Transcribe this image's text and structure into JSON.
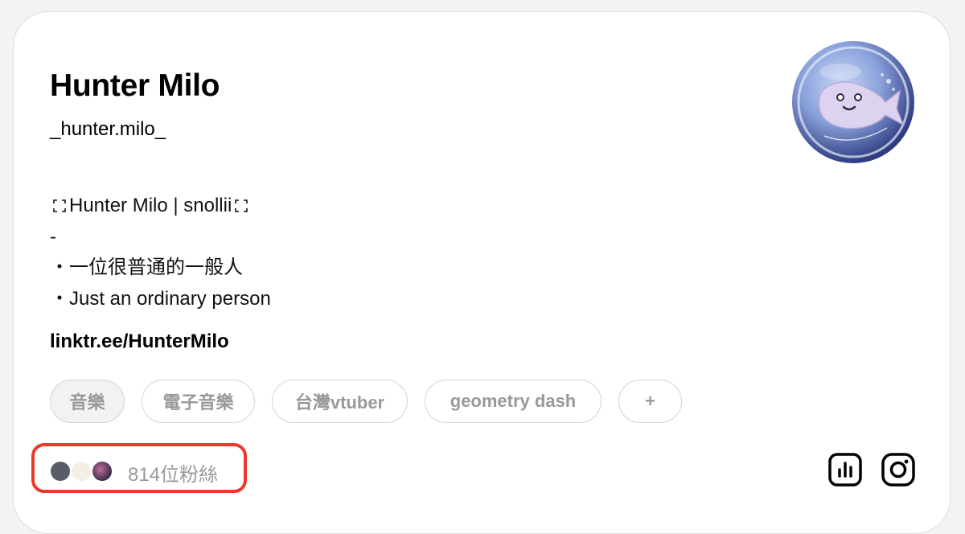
{
  "profile": {
    "name": "Hunter Milo",
    "handle": "_hunter.milo_",
    "bio": {
      "line1_text": "Hunter Milo | snollii",
      "line2": "-",
      "line3": "・一位很普通的一般人",
      "line4": "・Just an ordinary person"
    },
    "link": "linktr.ee/HunterMilo",
    "avatar_icon": "fish-bubble-avatar"
  },
  "tags": [
    "音樂",
    "電子音樂",
    "台灣vtuber",
    "geometry dash",
    "+"
  ],
  "followers": {
    "label": "814位粉絲",
    "avatar_colors": [
      "#5a5d67",
      "#f4efe4",
      "#3b2f48"
    ]
  },
  "actions": {
    "insights_icon": "bar-chart-icon",
    "instagram_icon": "instagram-icon"
  },
  "colors": {
    "highlight": "#e8392b",
    "tag_text": "#999999",
    "text": "#000000"
  }
}
